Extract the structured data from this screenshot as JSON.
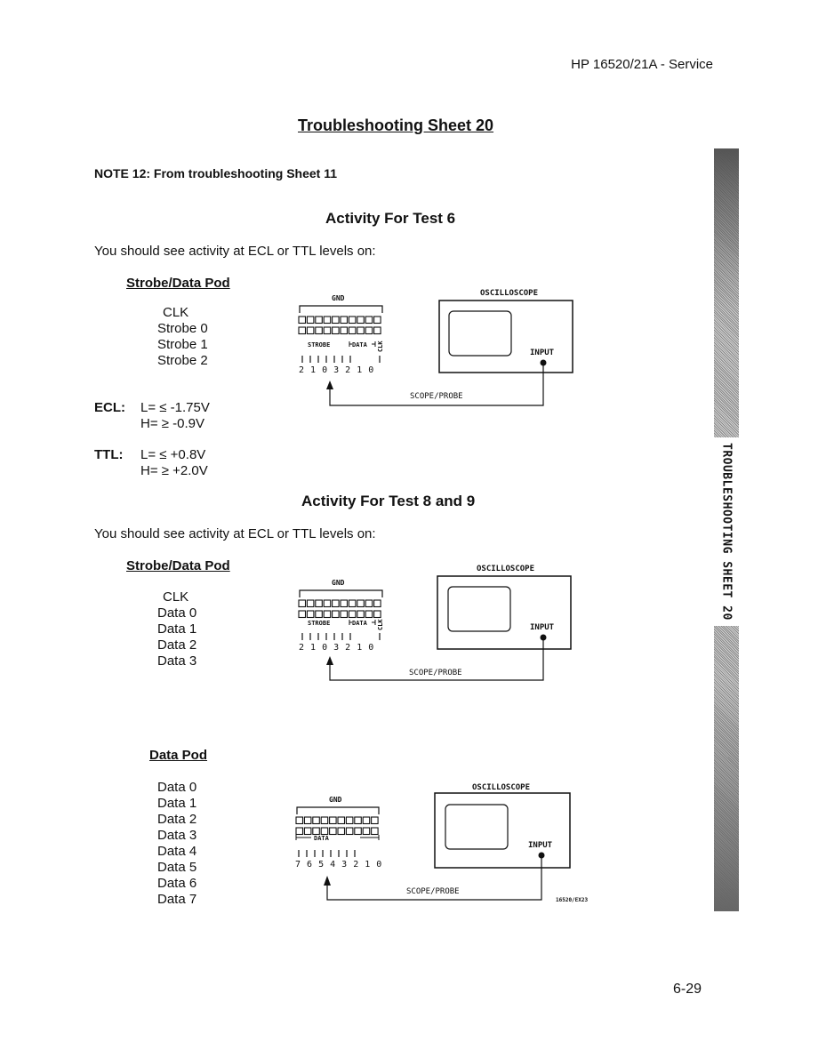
{
  "header": {
    "running_title": "HP 16520/21A - Service"
  },
  "page": {
    "title": "Troubleshooting Sheet 20",
    "number": "6-29"
  },
  "note": "NOTE 12:  From troubleshooting Sheet 11",
  "side_tab": {
    "label": "TROUBLESHOOTING SHEET 20"
  },
  "section1": {
    "heading": "Activity For Test 6",
    "intro": "You should see activity at ECL or TTL levels on:",
    "pod_heading": "Strobe/Data Pod",
    "signals": [
      "CLK",
      "Strobe 0",
      "Strobe 1",
      "Strobe 2"
    ],
    "levels": {
      "ecl_label": "ECL:",
      "ecl_low": "L= ≤ -1.75V",
      "ecl_high": "H= ≥ -0.9V",
      "ttl_label": "TTL:",
      "ttl_low": "L= ≤ +0.8V",
      "ttl_high": "H= ≥ +2.0V"
    },
    "diagram": {
      "gnd": "GND",
      "strobe": "STROBE",
      "data": "DATA",
      "clk": "CLK",
      "pins": "2 1 0 3 2 1 0",
      "scope": "OSCILLOSCOPE",
      "input": "INPUT",
      "probe": "SCOPE/PROBE"
    }
  },
  "section2": {
    "heading": "Activity For Test 8 and 9",
    "intro": "You should see activity at ECL or TTL levels on:",
    "pod_heading": "Strobe/Data Pod",
    "signals": [
      "CLK",
      "Data 0",
      "Data 1",
      "Data 2",
      "Data 3"
    ],
    "diagram": {
      "gnd": "GND",
      "strobe": "STROBE",
      "data": "DATA",
      "clk": "CLK",
      "pins": "2 1 0 3 2 1 0",
      "scope": "OSCILLOSCOPE",
      "input": "INPUT",
      "probe": "SCOPE/PROBE"
    }
  },
  "section3": {
    "pod_heading": "Data Pod",
    "signals": [
      "Data 0",
      "Data 1",
      "Data 2",
      "Data 3",
      "Data 4",
      "Data 5",
      "Data 6",
      "Data 7"
    ],
    "diagram": {
      "gnd": "GND",
      "data": "DATA",
      "pins": "7 6 5 4 3 2 1 0",
      "scope": "OSCILLOSCOPE",
      "input": "INPUT",
      "probe": "SCOPE/PROBE",
      "figure_id": "16520/EX23"
    }
  }
}
